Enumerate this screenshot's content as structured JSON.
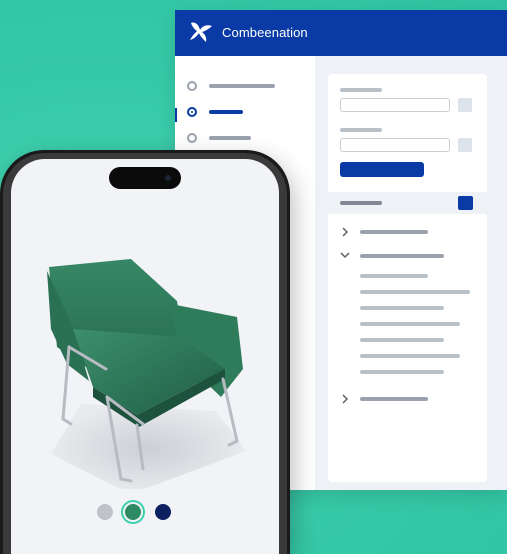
{
  "app": {
    "title": "Combeenation"
  },
  "colors": {
    "background": "#3ccfac",
    "brand": "#0a3aa6",
    "chair": "#2b7a5c",
    "swatch_grey": "#bfc3c8",
    "swatch_green": "#2e8a63",
    "swatch_navy": "#0d2160"
  },
  "sidebar": {
    "items": [
      {
        "icon": "radio-icon",
        "active": false
      },
      {
        "icon": "radio-icon",
        "active": true
      },
      {
        "icon": "radio-icon",
        "active": false
      }
    ]
  },
  "color_options": [
    {
      "name": "grey",
      "selected": false
    },
    {
      "name": "green",
      "selected": true
    },
    {
      "name": "navy",
      "selected": false
    }
  ]
}
